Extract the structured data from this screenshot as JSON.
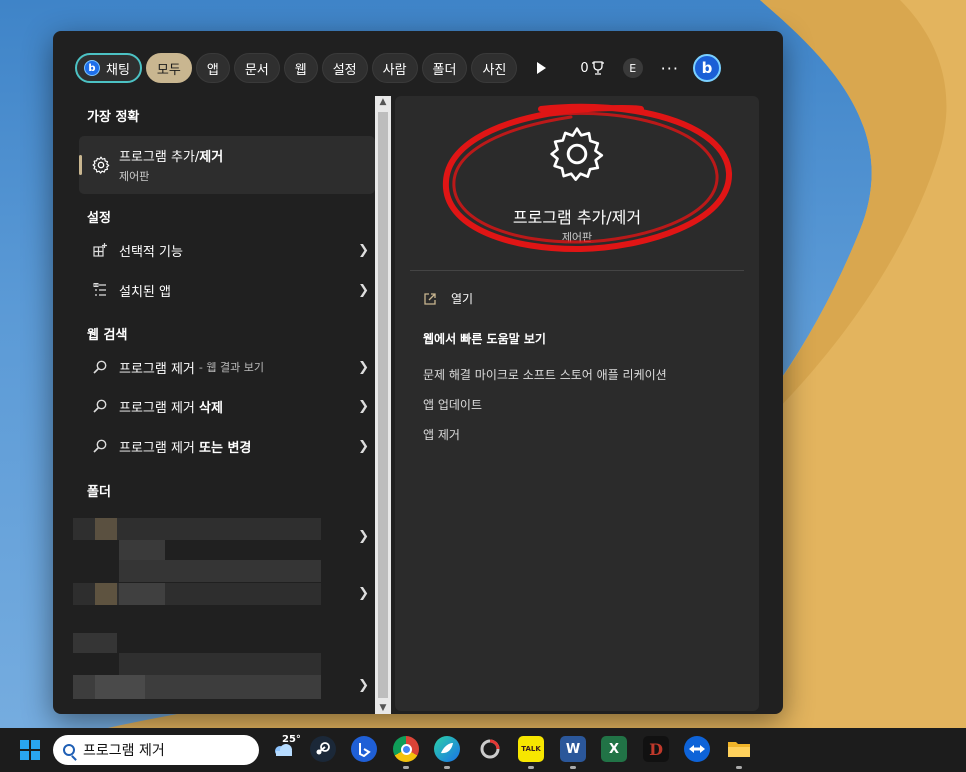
{
  "tabs": [
    {
      "label": "채팅"
    },
    {
      "label": "모두"
    },
    {
      "label": "앱"
    },
    {
      "label": "문서"
    },
    {
      "label": "웹"
    },
    {
      "label": "설정"
    },
    {
      "label": "사람"
    },
    {
      "label": "폴더"
    },
    {
      "label": "사진"
    }
  ],
  "header": {
    "points": "0",
    "avatar": "E",
    "more": "···",
    "bing_letter": "b"
  },
  "left": {
    "best_match_heading": "가장 정확",
    "best_match": {
      "title_plain": "프로그램 추가/",
      "title_bold": "제거",
      "subtitle": "제어판"
    },
    "settings_heading": "설정",
    "settings": [
      {
        "label": "선택적 기능",
        "icon": "optional-features-icon"
      },
      {
        "label": "설치된 앱",
        "icon": "installed-apps-icon"
      }
    ],
    "web_heading": "웹 검색",
    "web": [
      {
        "label": "프로그램 제거",
        "sub": "- 웹 결과 보기",
        "bold": ""
      },
      {
        "label": "프로그램 제거 ",
        "sub": "",
        "bold": "삭제"
      },
      {
        "label": "프로그램 제거 ",
        "sub": "",
        "bold": "또는 변경"
      }
    ],
    "folder_heading": "폴더"
  },
  "right": {
    "title": "프로그램 추가/제거",
    "subtitle": "제어판",
    "open_label": "열기",
    "help_heading": "웹에서 빠른 도움말 보기",
    "links": [
      "문제 해결 마이크로 소프트 스토어 애플 리케이션",
      "앱 업데이트",
      "앱 제거"
    ]
  },
  "taskbar": {
    "search_value": "프로그램 제거",
    "weather": "25°",
    "apps": [
      "weather-icon",
      "steam-icon",
      "bing-app-icon",
      "chrome-icon",
      "app-icon",
      "photo-app-icon",
      "kakaotalk-icon",
      "word-icon",
      "excel-icon",
      "diablo-icon",
      "teamviewer-icon",
      "file-explorer-icon"
    ],
    "kakao_label": "TALK",
    "word_letter": "W",
    "excel_letter": "X",
    "diablo_letter": "D"
  },
  "colors": {
    "accent": "#c9b690",
    "highlight_ring": "#e01515",
    "chat_border": "#4cc2c4"
  }
}
